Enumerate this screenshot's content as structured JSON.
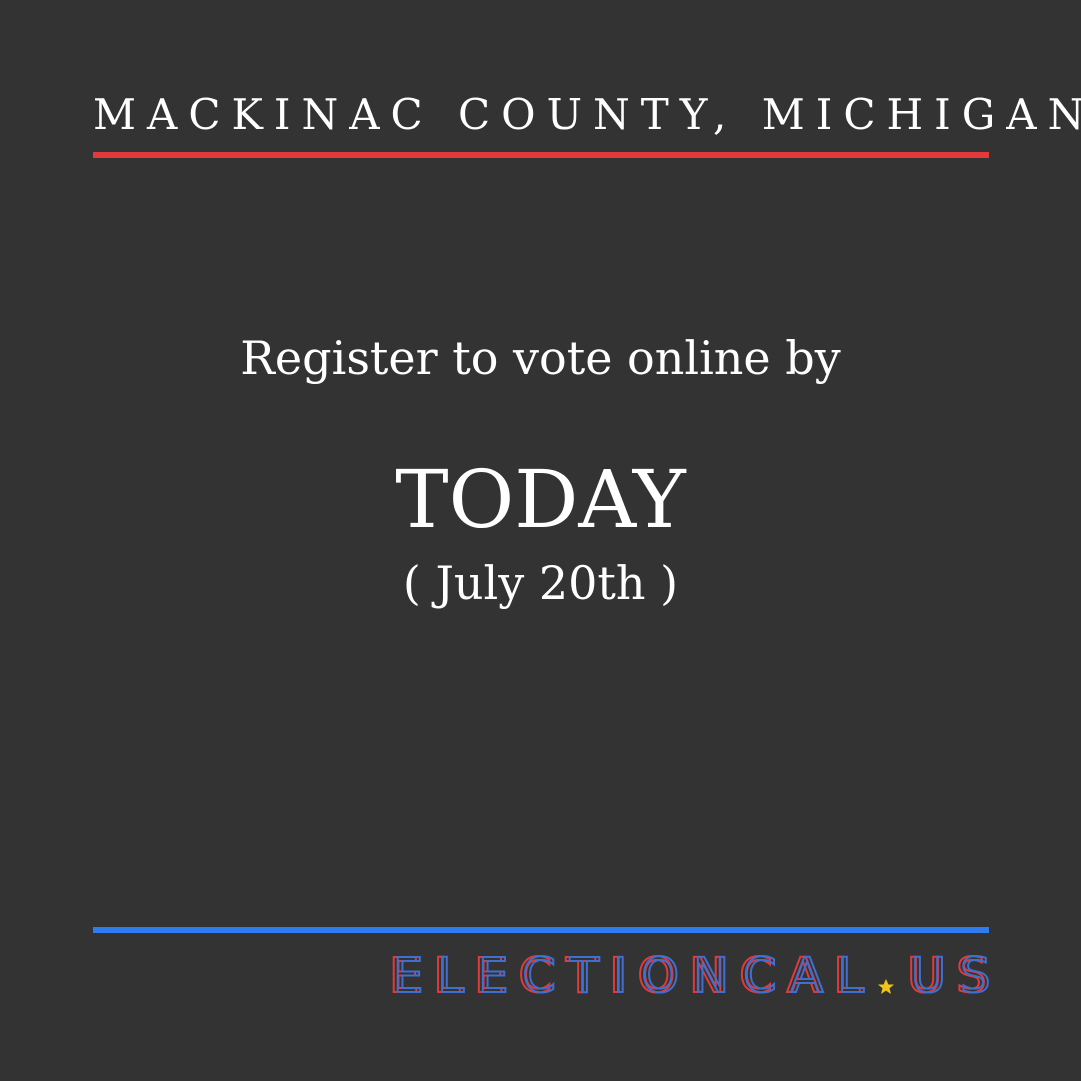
{
  "header": {
    "county": "MACKINAC COUNTY, MICHIGAN"
  },
  "message": {
    "headline": "Register to vote online by",
    "deadline": "TODAY",
    "date": "( July 20th )"
  },
  "logo": {
    "text_left": "ELECTIONCAL",
    "text_right": "US",
    "star_icon": "star-icon"
  },
  "colors": {
    "background": "#333333",
    "accent_red": "#e23a3a",
    "accent_blue": "#2f7cf0",
    "star_yellow": "#f2c417"
  }
}
